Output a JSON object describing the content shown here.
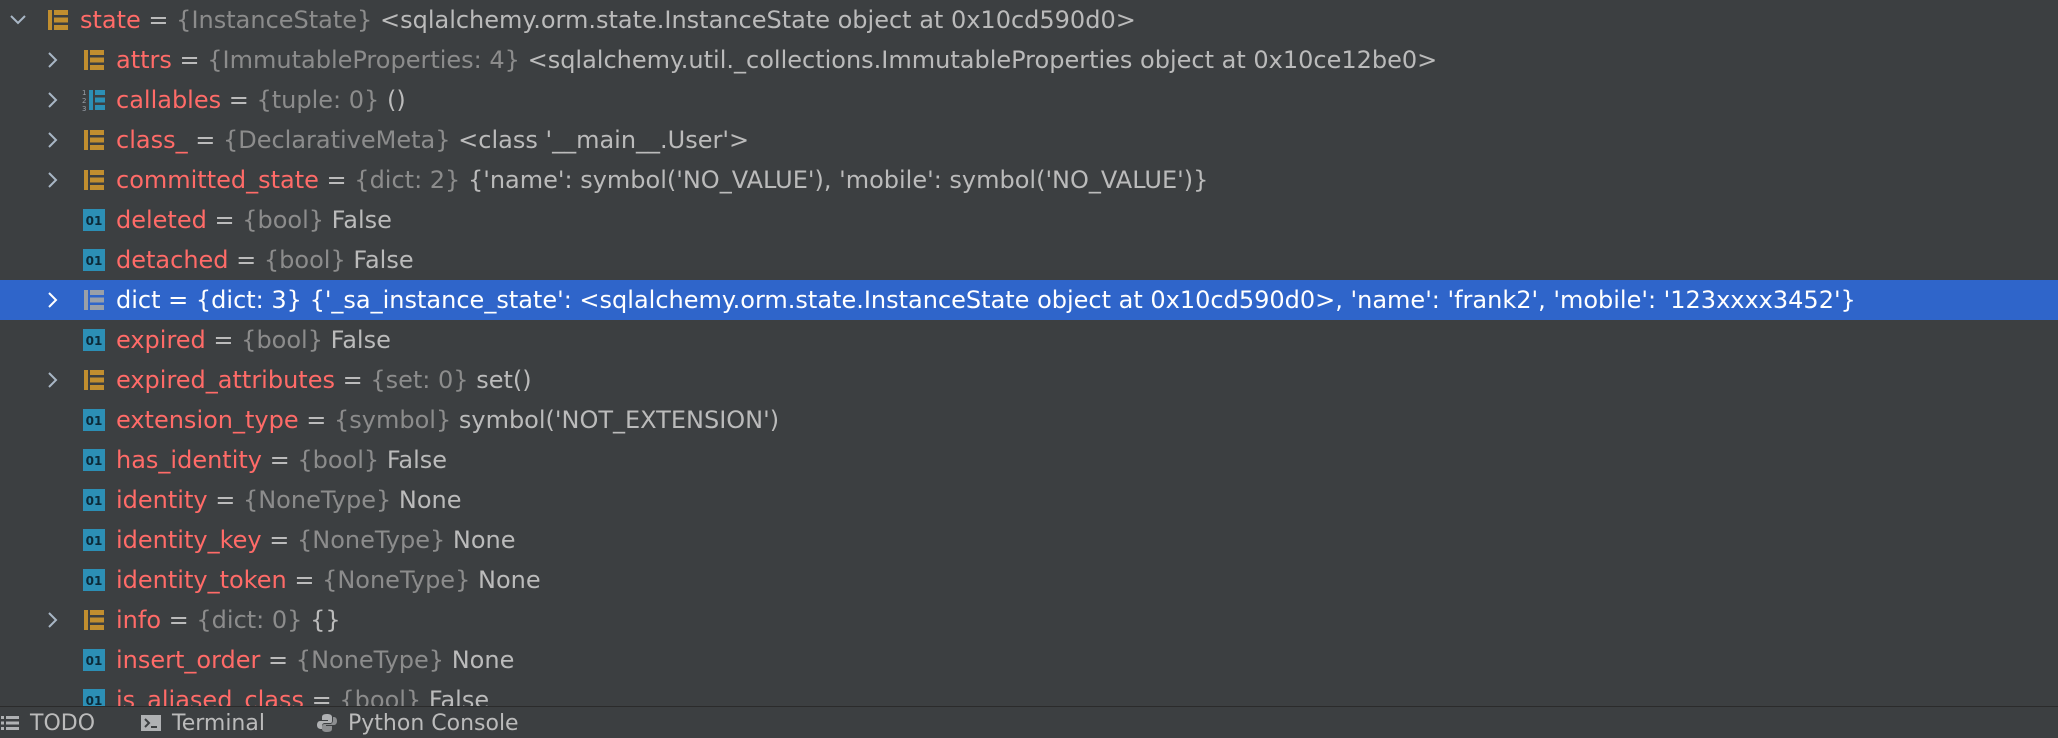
{
  "colors": {
    "background": "#3c3f41",
    "selection": "#2f65ca",
    "name": "#ff6b68",
    "type": "#8c8c8c",
    "value": "#bbbbbb",
    "object_icon": "#c18e2f",
    "primitive_icon": "#2c8fb5"
  },
  "tree": {
    "root": {
      "name": "state",
      "type": "{InstanceState}",
      "value": "<sqlalchemy.orm.state.InstanceState object at 0x10cd590d0>",
      "icon": "object-icon",
      "expanded": true
    },
    "children": [
      {
        "name": "attrs",
        "type": "{ImmutableProperties: 4}",
        "value": "<sqlalchemy.util._collections.ImmutableProperties object at 0x10ce12be0>",
        "icon": "object-icon",
        "expandable": true
      },
      {
        "name": "callables",
        "type": "{tuple: 0}",
        "value": "()",
        "icon": "list-icon",
        "expandable": true
      },
      {
        "name": "class_",
        "type": "{DeclarativeMeta}",
        "value": "<class '__main__.User'>",
        "icon": "object-icon",
        "expandable": true
      },
      {
        "name": "committed_state",
        "type": "{dict: 2}",
        "value": "{'name': symbol('NO_VALUE'), 'mobile': symbol('NO_VALUE')}",
        "icon": "object-icon",
        "expandable": true
      },
      {
        "name": "deleted",
        "type": "{bool}",
        "value": "False",
        "icon": "primitive-icon",
        "expandable": false
      },
      {
        "name": "detached",
        "type": "{bool}",
        "value": "False",
        "icon": "primitive-icon",
        "expandable": false
      },
      {
        "name": "dict",
        "type": "{dict: 3}",
        "value": "{'_sa_instance_state': <sqlalchemy.orm.state.InstanceState object at 0x10cd590d0>, 'name': 'frank2', 'mobile': '123xxxx3452'}",
        "icon": "object-icon",
        "expandable": true,
        "selected": true
      },
      {
        "name": "expired",
        "type": "{bool}",
        "value": "False",
        "icon": "primitive-icon",
        "expandable": false
      },
      {
        "name": "expired_attributes",
        "type": "{set: 0}",
        "value": "set()",
        "icon": "object-icon",
        "expandable": true
      },
      {
        "name": "extension_type",
        "type": "{symbol}",
        "value": "symbol('NOT_EXTENSION')",
        "icon": "primitive-icon",
        "expandable": false
      },
      {
        "name": "has_identity",
        "type": "{bool}",
        "value": "False",
        "icon": "primitive-icon",
        "expandable": false
      },
      {
        "name": "identity",
        "type": "{NoneType}",
        "value": "None",
        "icon": "primitive-icon",
        "expandable": false
      },
      {
        "name": "identity_key",
        "type": "{NoneType}",
        "value": "None",
        "icon": "primitive-icon",
        "expandable": false
      },
      {
        "name": "identity_token",
        "type": "{NoneType}",
        "value": "None",
        "icon": "primitive-icon",
        "expandable": false
      },
      {
        "name": "info",
        "type": "{dict: 0}",
        "value": "{}",
        "icon": "object-icon",
        "expandable": true
      },
      {
        "name": "insert_order",
        "type": "{NoneType}",
        "value": "None",
        "icon": "primitive-icon",
        "expandable": false
      },
      {
        "name": "is_aliased_class",
        "type": "{bool}",
        "value": "False",
        "icon": "primitive-icon",
        "expandable": false
      }
    ]
  },
  "bottom_bar": {
    "todo_label": "TODO",
    "terminal_label": "Terminal",
    "python_console_label": "Python Console"
  }
}
